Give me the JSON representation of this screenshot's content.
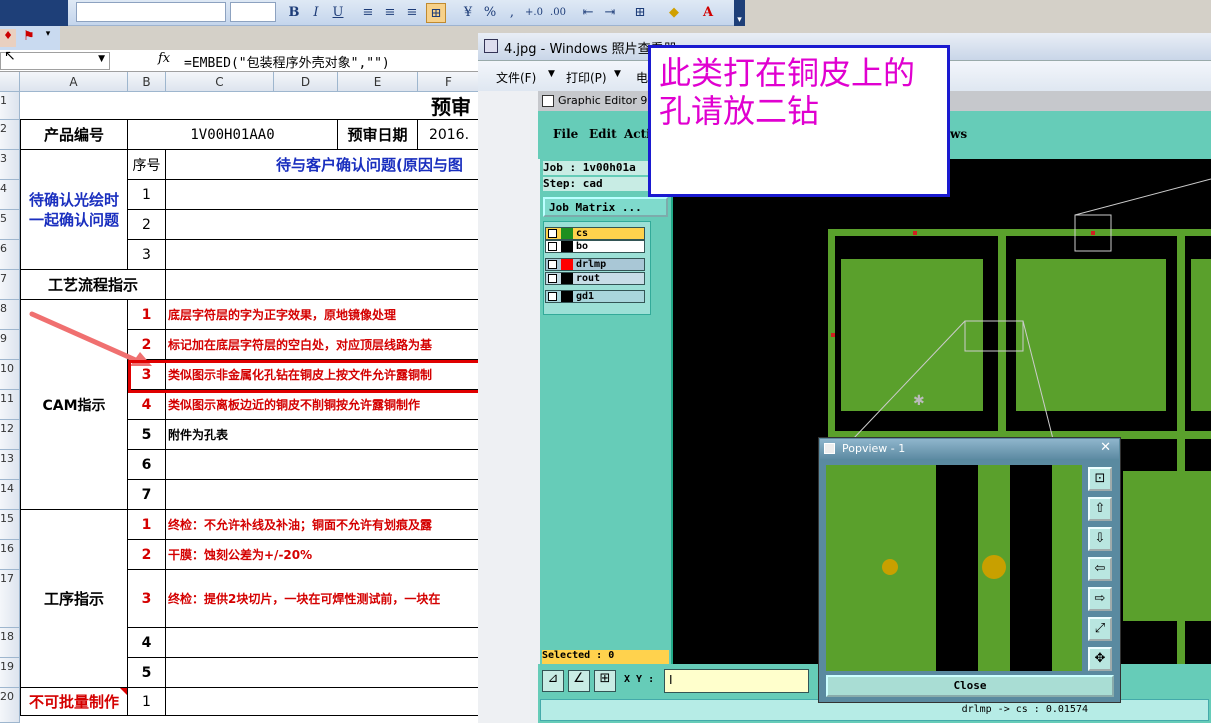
{
  "excel": {
    "namebox": "",
    "fx": "fx",
    "formula": "=EMBED(\"包装程序外壳对象\",\"\")",
    "columns": [
      "A",
      "B",
      "C",
      "D",
      "E",
      "F"
    ],
    "rows": [
      "1",
      "2",
      "3",
      "4",
      "5",
      "6",
      "7",
      "8",
      "9",
      "10",
      "11",
      "12",
      "13",
      "14",
      "15",
      "16",
      "17",
      "18",
      "19",
      "20"
    ],
    "title_partial": "预审",
    "product_no_label": "产品编号",
    "product_no": "1V00H01AA0",
    "review_date_label": "预审日期",
    "review_date": "2016.",
    "pending_label": "待确认光绘时一起确认问题",
    "seq_label": "序号",
    "customer_header": "待与客户确认问题(原因与图",
    "pending_items": [
      "1",
      "2",
      "3"
    ],
    "process_flow_label": "工艺流程指示",
    "cam_label": "CAM指示",
    "cam_items": [
      {
        "no": "1",
        "text": "底层字符层的字为正字效果，原地镜像处理",
        "color": "red"
      },
      {
        "no": "2",
        "text": "标记加在底层字符层的空白处，对应顶层线路为基",
        "color": "red"
      },
      {
        "no": "3",
        "text": "类似图示非金属化孔钻在铜皮上按文件允许露铜制",
        "color": "red"
      },
      {
        "no": "4",
        "text": "类似图示离板边近的铜皮不削铜按允许露铜制作",
        "color": "red"
      },
      {
        "no": "5",
        "text": "附件为孔表",
        "color": "black"
      },
      {
        "no": "6",
        "text": "",
        "color": "black"
      },
      {
        "no": "7",
        "text": "",
        "color": "black"
      }
    ],
    "process_label": "工序指示",
    "process_items": [
      {
        "no": "1",
        "text": "终检：不允许补线及补油；铜面不允许有划痕及露",
        "color": "red"
      },
      {
        "no": "2",
        "text": "干膜：蚀刻公差为+/-20%",
        "color": "red"
      },
      {
        "no": "3",
        "text": "终检：提供2块切片，一块在可焊性测试前，一块在",
        "color": "red"
      },
      {
        "no": "4",
        "text": "",
        "color": "black"
      },
      {
        "no": "5",
        "text": "",
        "color": "black"
      }
    ],
    "no_batch_label": "不可批量制作",
    "no_batch_item": "1"
  },
  "photo_viewer": {
    "title": "4.jpg - Windows 照片查看器",
    "menu": [
      "文件(F)",
      "打印(P)",
      "电"
    ]
  },
  "graphic_editor": {
    "title": "Graphic Editor 9.0",
    "menu": [
      "File",
      "Edit",
      "Actio",
      "ws"
    ],
    "job": "Job : 1v00h01a",
    "step": "Step: cad",
    "job_matrix": "Job Matrix ...",
    "layers": [
      {
        "name": "cs",
        "swatch": "#1f8f1f",
        "bg": "#ffd24d"
      },
      {
        "name": "bo",
        "swatch": "#000000",
        "bg": "#ffffff"
      },
      {
        "name": "drlmp",
        "swatch": "#ff0000",
        "bg": "#a9c7d6"
      },
      {
        "name": "rout",
        "swatch": "#000000",
        "bg": "#c7dde6"
      },
      {
        "name": "gd1",
        "swatch": "#000000",
        "bg": "#a9d6dc"
      }
    ],
    "selected": "Selected : 0",
    "xy_label": "X Y :",
    "status": "drlmp -> cs : 0.01574"
  },
  "popview": {
    "title": "Popview - 1",
    "close_label": "Close"
  },
  "annotation": {
    "text": "此类打在铜皮上的孔请放二钻"
  },
  "colors": {
    "pcb_green": "#5aa02c",
    "pcb_pad": "#c8a000",
    "note_text": "#e000d0",
    "highlight": "#e00000"
  }
}
